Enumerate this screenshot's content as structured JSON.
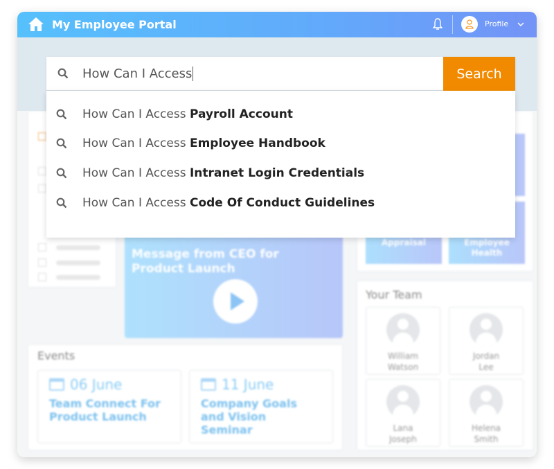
{
  "header": {
    "title": "My Employee Portal",
    "profile_label": "Profile"
  },
  "search": {
    "value": "How Can I Access",
    "button_label": "Search",
    "suggestions": [
      {
        "prefix": "How Can I Access",
        "bold": "Payroll Account"
      },
      {
        "prefix": "How Can I Access",
        "bold": "Employee Handbook"
      },
      {
        "prefix": "How Can I Access",
        "bold": "Intranet Login Credentials"
      },
      {
        "prefix": "How Can I Access",
        "bold": "Code Of Conduct Guidelines"
      }
    ]
  },
  "video": {
    "title": "Message from CEO for Product Launch"
  },
  "tiles": [
    {
      "label": "Appraisal"
    },
    {
      "label": "Employee Health"
    }
  ],
  "team": {
    "heading": "Your Team",
    "members": [
      {
        "name": "William Watson"
      },
      {
        "name": "Jordan Lee"
      },
      {
        "name": "Lana Joseph"
      },
      {
        "name": "Helena Smith"
      }
    ]
  },
  "events": {
    "heading": "Events",
    "items": [
      {
        "date": "06 June",
        "title": "Team Connect For Product Launch"
      },
      {
        "date": "11 June",
        "title": "Company Goals and Vision Seminar"
      }
    ]
  },
  "colors": {
    "accent": "#f28a00",
    "header_start": "#56c0fc",
    "header_end": "#7393f6"
  }
}
